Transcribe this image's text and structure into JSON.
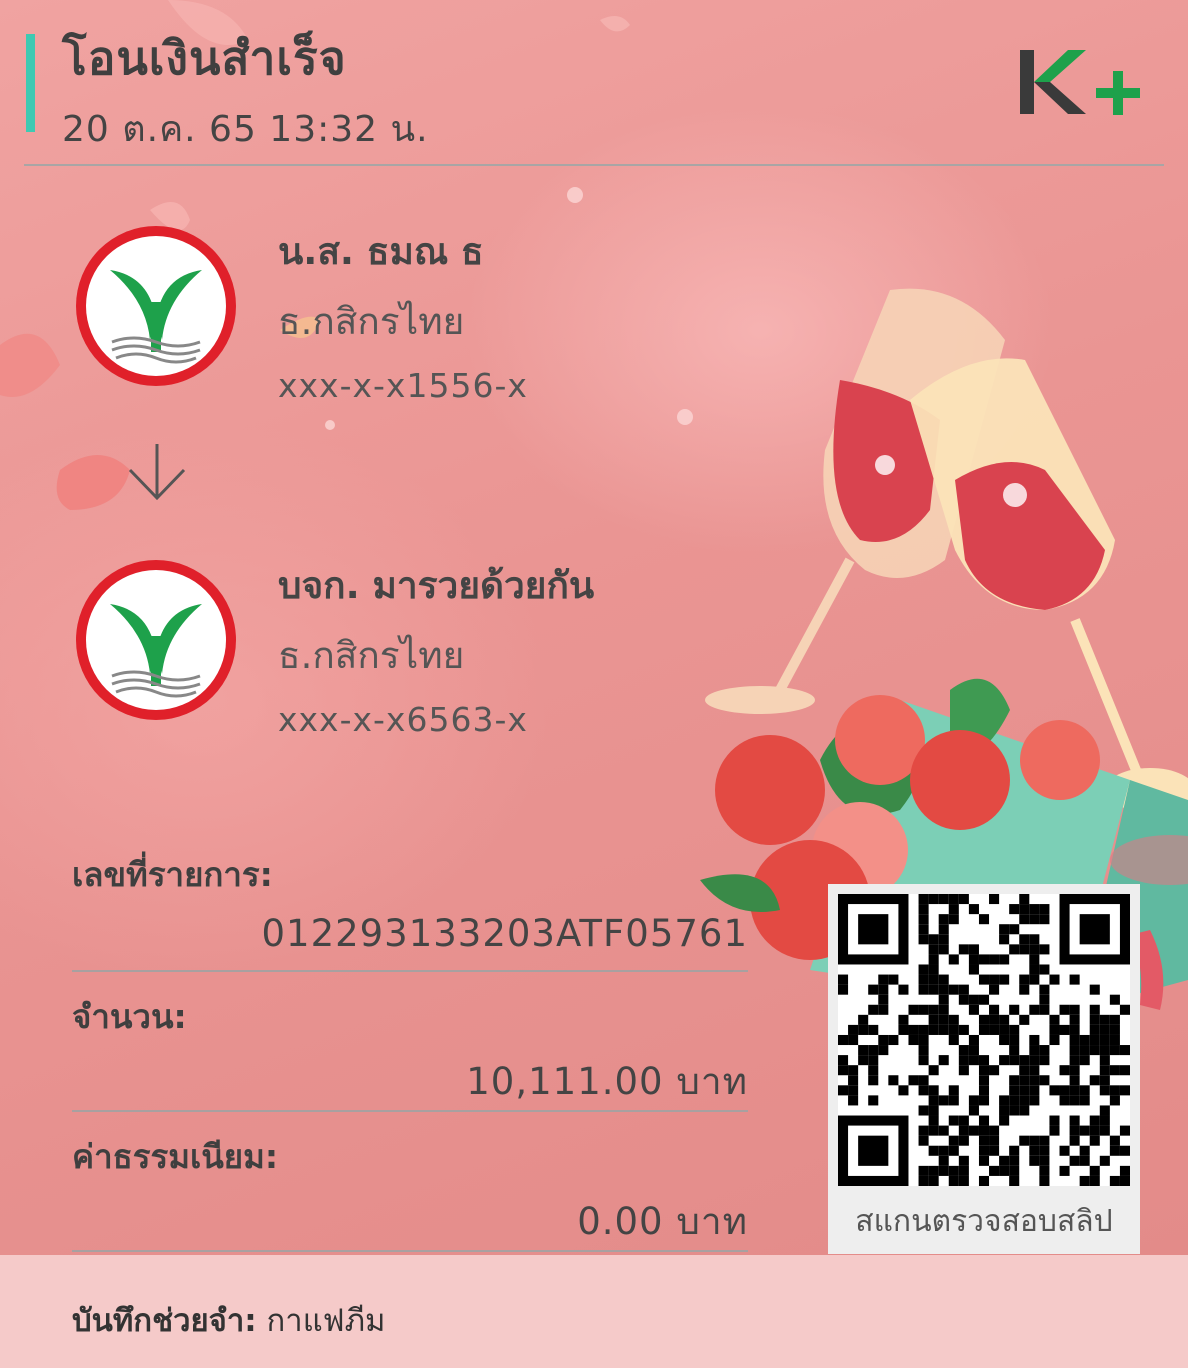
{
  "header": {
    "title": "โอนเงินสำเร็จ",
    "datetime": "20 ต.ค. 65  13:32 น.",
    "logo_text": "K+"
  },
  "sender": {
    "name": "น.ส. ธมณ ธ",
    "bank": "ธ.กสิกรไทย",
    "account": "xxx-x-x1556-x",
    "logo_icon": "kbank-logo-icon"
  },
  "receiver": {
    "name": "บจก. มารวยด้วยกัน",
    "bank": "ธ.กสิกรไทย",
    "account": "xxx-x-x6563-x",
    "logo_icon": "kbank-logo-icon"
  },
  "details": {
    "ref_label": "เลขที่รายการ:",
    "ref_value": "012293133203ATF05761",
    "amount_label": "จำนวน:",
    "amount_value": "10,111.00 บาท",
    "fee_label": "ค่าธรรมเนียม:",
    "fee_value": "0.00 บาท"
  },
  "qr": {
    "caption": "สแกนตรวจสอบสลิป",
    "icon": "qr-code-icon"
  },
  "memo": {
    "label": "บันทึกช่วยจำ:",
    "value": "กาแฟภีม"
  },
  "colors": {
    "accent": "#3ec9b2",
    "kbank_green": "#1ea14b",
    "kbank_red": "#e0202a",
    "background": "#e99391",
    "footer": "#f5cac9"
  }
}
